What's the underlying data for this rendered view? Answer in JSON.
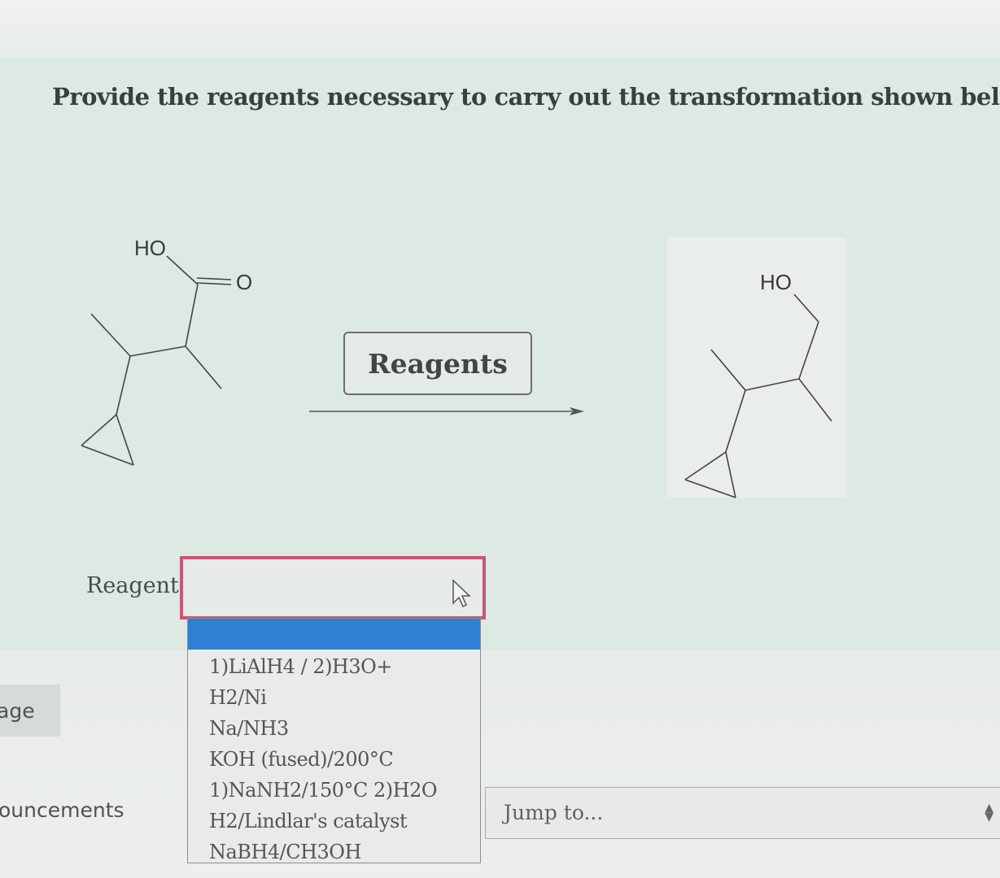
{
  "question": {
    "text": "Provide the reagents necessary to carry out the transformation shown below."
  },
  "reactant": {
    "ho_label": "HO",
    "o_label": "O"
  },
  "product": {
    "ho_label": "HO"
  },
  "reagents_box": {
    "label": "Reagents"
  },
  "form": {
    "reagent_label": "Reagent",
    "selected_value": "",
    "options": [
      "",
      "1)LiAlH4 / 2)H3O+",
      "H2/Ni",
      "Na/NH3",
      "KOH (fused)/200°C",
      "1)NaNH2/150°C 2)H2O",
      "H2/Lindlar's catalyst",
      "NaBH4/CH3OH"
    ],
    "highlight_color": "#2f7fd3",
    "focus_border_color": "#c95577"
  },
  "side_nav": {
    "page_text": "age",
    "announcements_text": "ouncements"
  },
  "jump_to": {
    "placeholder": "Jump to..."
  }
}
